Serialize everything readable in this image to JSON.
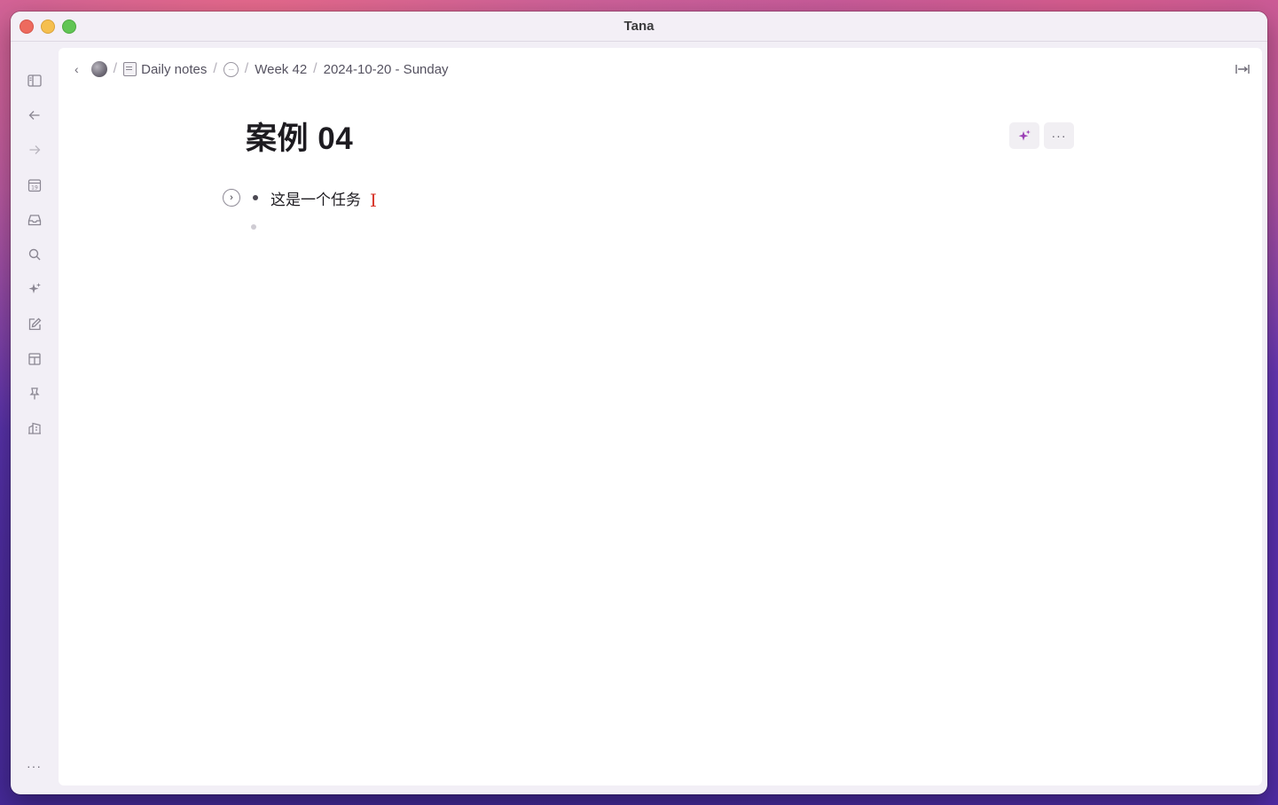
{
  "window": {
    "title": "Tana"
  },
  "sidebar": {
    "items": [
      {
        "name": "toggle-sidebar",
        "icon": "sidebar-icon"
      },
      {
        "name": "back",
        "icon": "arrow-left-icon"
      },
      {
        "name": "forward",
        "icon": "arrow-right-icon"
      },
      {
        "name": "calendar",
        "icon": "calendar-icon",
        "label": "19"
      },
      {
        "name": "inbox",
        "icon": "inbox-icon"
      },
      {
        "name": "search",
        "icon": "search-icon"
      },
      {
        "name": "ai",
        "icon": "sparkle-icon"
      },
      {
        "name": "edit",
        "icon": "edit-icon"
      },
      {
        "name": "layout",
        "icon": "layout-icon"
      },
      {
        "name": "pin",
        "icon": "pin-icon"
      },
      {
        "name": "workspace",
        "icon": "building-icon"
      }
    ],
    "more_label": "···"
  },
  "breadcrumb": {
    "back_label": "‹",
    "items": [
      {
        "label": "Daily notes"
      },
      {
        "label": "Week 42"
      },
      {
        "label": "2024-10-20 - Sunday"
      }
    ],
    "more_label": "···"
  },
  "page": {
    "title": "案例 04",
    "ai_button_icon": "sparkle-icon",
    "more_label": "···",
    "nodes": [
      {
        "text": "这是一个任务",
        "expand_label": "›"
      },
      {
        "text": ""
      }
    ]
  },
  "colors": {
    "accent_sparkle": "#9b3fb5",
    "cursor": "#d7352a"
  }
}
